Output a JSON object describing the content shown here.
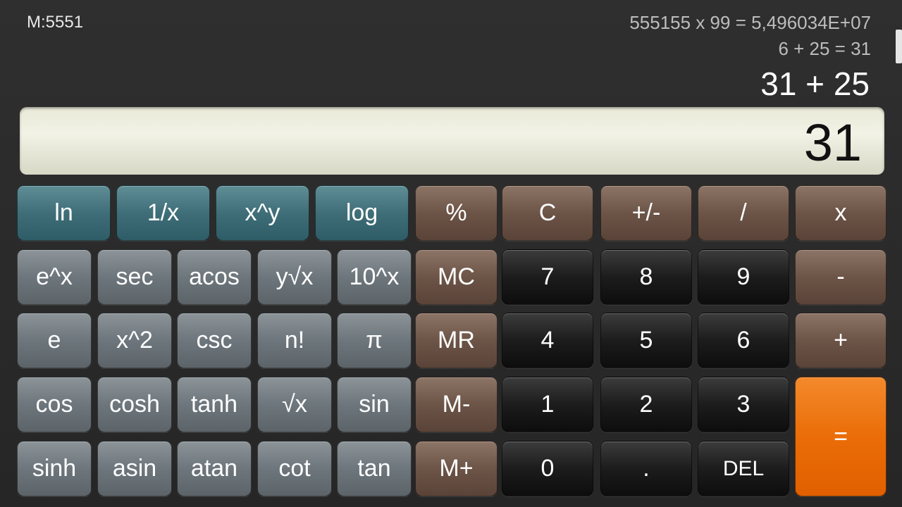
{
  "memory": "M:5551",
  "history": [
    "555155 x 99 = 5,496034E+07",
    "6 + 25 = 31"
  ],
  "expression": "31 + 25",
  "result": "31",
  "keys": {
    "ln": "ln",
    "reciprocal": "1/x",
    "x_pow_y": "x^y",
    "log": "log",
    "percent": "%",
    "clear": "C",
    "plus_minus": "+/-",
    "divide": "/",
    "multiply": "x",
    "e_pow_x": "e^x",
    "sec": "sec",
    "acos": "acos",
    "y_root_x": "y√x",
    "ten_pow_x": "10^x",
    "mc": "MC",
    "d7": "7",
    "d8": "8",
    "d9": "9",
    "minus": "-",
    "e": "e",
    "x_sq": "x^2",
    "csc": "csc",
    "factorial": "n!",
    "pi": "π",
    "mr": "MR",
    "d4": "4",
    "d5": "5",
    "d6": "6",
    "plus": "+",
    "cos": "cos",
    "cosh": "cosh",
    "tanh": "tanh",
    "sqrt": "√x",
    "sin": "sin",
    "m_minus": "M-",
    "d1": "1",
    "d2": "2",
    "d3": "3",
    "equals": "=",
    "sinh": "sinh",
    "asin": "asin",
    "atan": "atan",
    "cot": "cot",
    "tan": "tan",
    "m_plus": "M+",
    "d0": "0",
    "dot": ".",
    "del": "DEL"
  }
}
